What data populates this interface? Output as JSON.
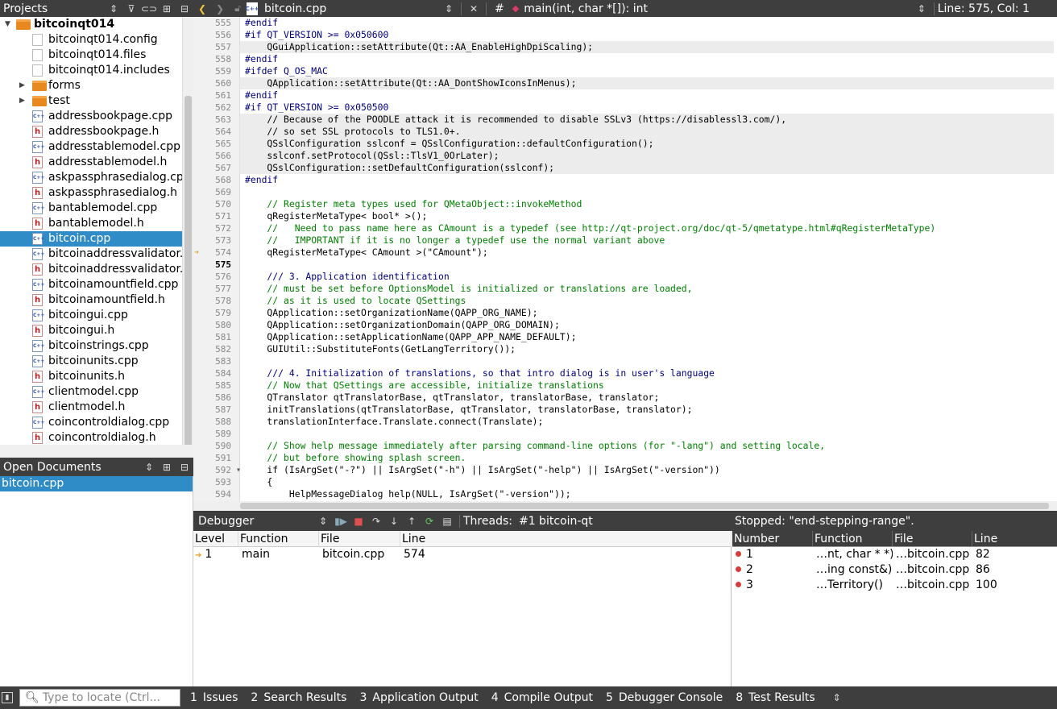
{
  "projects_panel": {
    "title": "Projects",
    "items": [
      {
        "label": "bitcoinqt014",
        "type": "project",
        "indent": 0
      },
      {
        "label": "bitcoinqt014.config",
        "type": "file",
        "indent": 1
      },
      {
        "label": "bitcoinqt014.files",
        "type": "file",
        "indent": 1
      },
      {
        "label": "bitcoinqt014.includes",
        "type": "file",
        "indent": 1
      },
      {
        "label": "forms",
        "type": "folder",
        "indent": 1
      },
      {
        "label": "test",
        "type": "folder",
        "indent": 1
      },
      {
        "label": "addressbookpage.cpp",
        "type": "cpp",
        "indent": 1
      },
      {
        "label": "addressbookpage.h",
        "type": "h",
        "indent": 1
      },
      {
        "label": "addresstablemodel.cpp",
        "type": "cpp",
        "indent": 1
      },
      {
        "label": "addresstablemodel.h",
        "type": "h",
        "indent": 1
      },
      {
        "label": "askpassphrasedialog.cpp",
        "type": "cpp",
        "indent": 1
      },
      {
        "label": "askpassphrasedialog.h",
        "type": "h",
        "indent": 1
      },
      {
        "label": "bantablemodel.cpp",
        "type": "cpp",
        "indent": 1
      },
      {
        "label": "bantablemodel.h",
        "type": "h",
        "indent": 1
      },
      {
        "label": "bitcoin.cpp",
        "type": "cpp",
        "indent": 1,
        "selected": true
      },
      {
        "label": "bitcoinaddressvalidator.cpp",
        "type": "cpp",
        "indent": 1
      },
      {
        "label": "bitcoinaddressvalidator.h",
        "type": "h",
        "indent": 1
      },
      {
        "label": "bitcoinamountfield.cpp",
        "type": "cpp",
        "indent": 1
      },
      {
        "label": "bitcoinamountfield.h",
        "type": "h",
        "indent": 1
      },
      {
        "label": "bitcoingui.cpp",
        "type": "cpp",
        "indent": 1
      },
      {
        "label": "bitcoingui.h",
        "type": "h",
        "indent": 1
      },
      {
        "label": "bitcoinstrings.cpp",
        "type": "cpp",
        "indent": 1
      },
      {
        "label": "bitcoinunits.cpp",
        "type": "cpp",
        "indent": 1
      },
      {
        "label": "bitcoinunits.h",
        "type": "h",
        "indent": 1
      },
      {
        "label": "clientmodel.cpp",
        "type": "cpp",
        "indent": 1
      },
      {
        "label": "clientmodel.h",
        "type": "h",
        "indent": 1
      },
      {
        "label": "coincontroldialog.cpp",
        "type": "cpp",
        "indent": 1
      },
      {
        "label": "coincontroldialog.h",
        "type": "h",
        "indent": 1
      }
    ]
  },
  "open_documents": {
    "title": "Open Documents",
    "items": [
      {
        "label": "bitcoin.cpp",
        "selected": true
      }
    ]
  },
  "editor": {
    "file_name": "bitcoin.cpp",
    "symbol": "main(int, char *[]): int",
    "position": "Line: 575, Col: 1",
    "hash_label": "#",
    "current_line": 575,
    "lines": [
      {
        "n": 555,
        "text": "#endif",
        "cls": "pp"
      },
      {
        "n": 556,
        "text": "#if QT_VERSION >= 0x050600",
        "cls": "pp"
      },
      {
        "n": 557,
        "text": "    QGuiApplication::setAttribute(Qt::AA_EnableHighDpiScaling);",
        "cls": "",
        "blk": true
      },
      {
        "n": 558,
        "text": "#endif",
        "cls": "pp"
      },
      {
        "n": 559,
        "text": "#ifdef Q_OS_MAC",
        "cls": "pp"
      },
      {
        "n": 560,
        "text": "    QApplication::setAttribute(Qt::AA_DontShowIconsInMenus);",
        "cls": "",
        "blk": true
      },
      {
        "n": 561,
        "text": "#endif",
        "cls": "pp"
      },
      {
        "n": 562,
        "text": "#if QT_VERSION >= 0x050500",
        "cls": "pp"
      },
      {
        "n": 563,
        "text": "    // Because of the POODLE attack it is recommended to disable SSLv3 (https://disablessl3.com/),",
        "cls": "",
        "blk": true
      },
      {
        "n": 564,
        "text": "    // so set SSL protocols to TLS1.0+.",
        "cls": "",
        "blk": true
      },
      {
        "n": 565,
        "text": "    QSslConfiguration sslconf = QSslConfiguration::defaultConfiguration();",
        "cls": "",
        "blk": true
      },
      {
        "n": 566,
        "text": "    sslconf.setProtocol(QSsl::TlsV1_0OrLater);",
        "cls": "",
        "blk": true
      },
      {
        "n": 567,
        "text": "    QSslConfiguration::setDefaultConfiguration(sslconf);",
        "cls": "",
        "blk": true
      },
      {
        "n": 568,
        "text": "#endif",
        "cls": "pp"
      },
      {
        "n": 569,
        "text": "",
        "cls": ""
      },
      {
        "n": 570,
        "text": "    // Register meta types used for QMetaObject::invokeMethod",
        "cls": "cm"
      },
      {
        "n": 571,
        "text": "    qRegisterMetaType< bool* >();",
        "cls": ""
      },
      {
        "n": 572,
        "text": "    //   Need to pass name here as CAmount is a typedef (see http://qt-project.org/doc/qt-5/qmetatype.html#qRegisterMetaType)",
        "cls": "cm"
      },
      {
        "n": 573,
        "text": "    //   IMPORTANT if it is no longer a typedef use the normal variant above",
        "cls": "cm"
      },
      {
        "n": 574,
        "text": "    qRegisterMetaType< CAmount >(\"CAmount\");",
        "cls": ""
      },
      {
        "n": 575,
        "text": "",
        "cls": ""
      },
      {
        "n": 576,
        "text": "    /// 3. Application identification",
        "cls": "mac"
      },
      {
        "n": 577,
        "text": "    // must be set before OptionsModel is initialized or translations are loaded,",
        "cls": "cm"
      },
      {
        "n": 578,
        "text": "    // as it is used to locate QSettings",
        "cls": "cm"
      },
      {
        "n": 579,
        "text": "    QApplication::setOrganizationName(QAPP_ORG_NAME);",
        "cls": ""
      },
      {
        "n": 580,
        "text": "    QApplication::setOrganizationDomain(QAPP_ORG_DOMAIN);",
        "cls": ""
      },
      {
        "n": 581,
        "text": "    QApplication::setApplicationName(QAPP_APP_NAME_DEFAULT);",
        "cls": ""
      },
      {
        "n": 582,
        "text": "    GUIUtil::SubstituteFonts(GetLangTerritory());",
        "cls": ""
      },
      {
        "n": 583,
        "text": "",
        "cls": ""
      },
      {
        "n": 584,
        "text": "    /// 4. Initialization of translations, so that intro dialog is in user's language",
        "cls": "mac"
      },
      {
        "n": 585,
        "text": "    // Now that QSettings are accessible, initialize translations",
        "cls": "cm"
      },
      {
        "n": 586,
        "text": "    QTranslator qtTranslatorBase, qtTranslator, translatorBase, translator;",
        "cls": ""
      },
      {
        "n": 587,
        "text": "    initTranslations(qtTranslatorBase, qtTranslator, translatorBase, translator);",
        "cls": ""
      },
      {
        "n": 588,
        "text": "    translationInterface.Translate.connect(Translate);",
        "cls": ""
      },
      {
        "n": 589,
        "text": "",
        "cls": ""
      },
      {
        "n": 590,
        "text": "    // Show help message immediately after parsing command-line options (for \"-lang\") and setting locale,",
        "cls": "cm"
      },
      {
        "n": 591,
        "text": "    // but before showing splash screen.",
        "cls": "cm"
      },
      {
        "n": 592,
        "text": "    if (IsArgSet(\"-?\") || IsArgSet(\"-h\") || IsArgSet(\"-help\") || IsArgSet(\"-version\"))",
        "cls": ""
      },
      {
        "n": 593,
        "text": "    {",
        "cls": ""
      },
      {
        "n": 594,
        "text": "        HelpMessageDialog help(NULL, IsArgSet(\"-version\"));",
        "cls": ""
      }
    ]
  },
  "debugger": {
    "title": "Debugger",
    "threads_label": "Threads:",
    "thread_value": "#1 bitcoin-qt",
    "status": "Stopped: \"end-stepping-range\".",
    "stack_headers": [
      "Level",
      "Function",
      "File",
      "Line"
    ],
    "stack_rows": [
      {
        "level": "1",
        "function": "main",
        "file": "bitcoin.cpp",
        "line": "574"
      }
    ],
    "bp_headers": [
      "Number",
      "Function",
      "File",
      "Line"
    ],
    "bp_rows": [
      {
        "number": "1",
        "function": "…nt, char * *)",
        "file": "…bitcoin.cpp",
        "line": "82"
      },
      {
        "number": "2",
        "function": "…ing const&)",
        "file": "…bitcoin.cpp",
        "line": "86"
      },
      {
        "number": "3",
        "function": "…Territory()",
        "file": "…bitcoin.cpp",
        "line": "100"
      }
    ]
  },
  "bottom_bar": {
    "locate_placeholder": "Type to locate (Ctrl...",
    "tabs": [
      {
        "num": "1",
        "label": "Issues"
      },
      {
        "num": "2",
        "label": "Search Results"
      },
      {
        "num": "3",
        "label": "Application Output"
      },
      {
        "num": "4",
        "label": "Compile Output"
      },
      {
        "num": "5",
        "label": "Debugger Console"
      },
      {
        "num": "8",
        "label": "Test Results"
      }
    ]
  },
  "colors": {
    "selection": "#308cc6",
    "bar": "#3e3e3e",
    "breakpoint": "#d63c3c"
  }
}
